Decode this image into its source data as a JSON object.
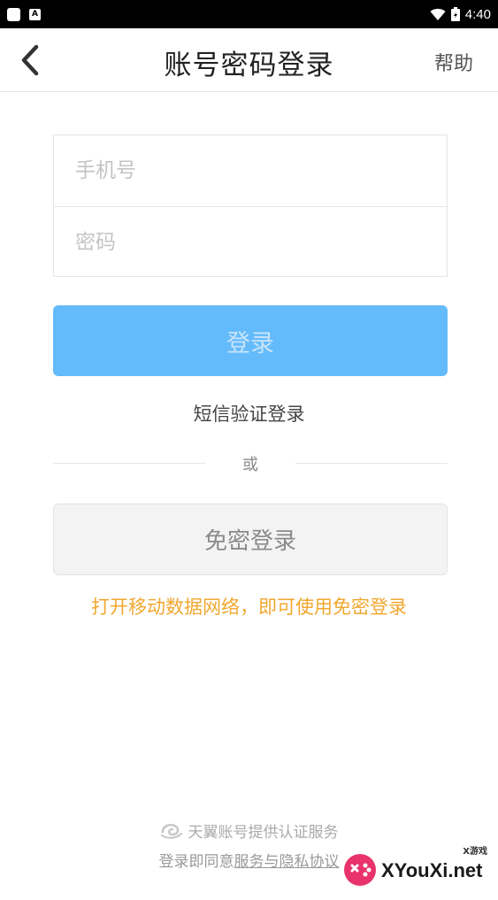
{
  "status_bar": {
    "time": "4:40",
    "notification_badge": "A"
  },
  "nav": {
    "title": "账号密码登录",
    "help_label": "帮助",
    "back_icon": "chevron-left-icon"
  },
  "form": {
    "phone_placeholder": "手机号",
    "phone_value": "",
    "password_placeholder": "密码",
    "password_value": ""
  },
  "login_button_label": "登录",
  "sms_login_label": "短信验证登录",
  "divider_label": "或",
  "free_login_button_label": "免密登录",
  "mobile_data_hint": "打开移动数据网络，即可使用免密登录",
  "footer": {
    "provider_text": "天翼账号提供认证服务",
    "agreement_prefix": "登录即同意",
    "agreement_link": "服务与隐私协议"
  },
  "watermark": {
    "text": "XYouXi.net",
    "sub": "X游戏"
  },
  "colors": {
    "login_button_bg": "#64bbfb",
    "hint_text": "#f0a830",
    "free_button_bg": "#f3f3f3"
  }
}
